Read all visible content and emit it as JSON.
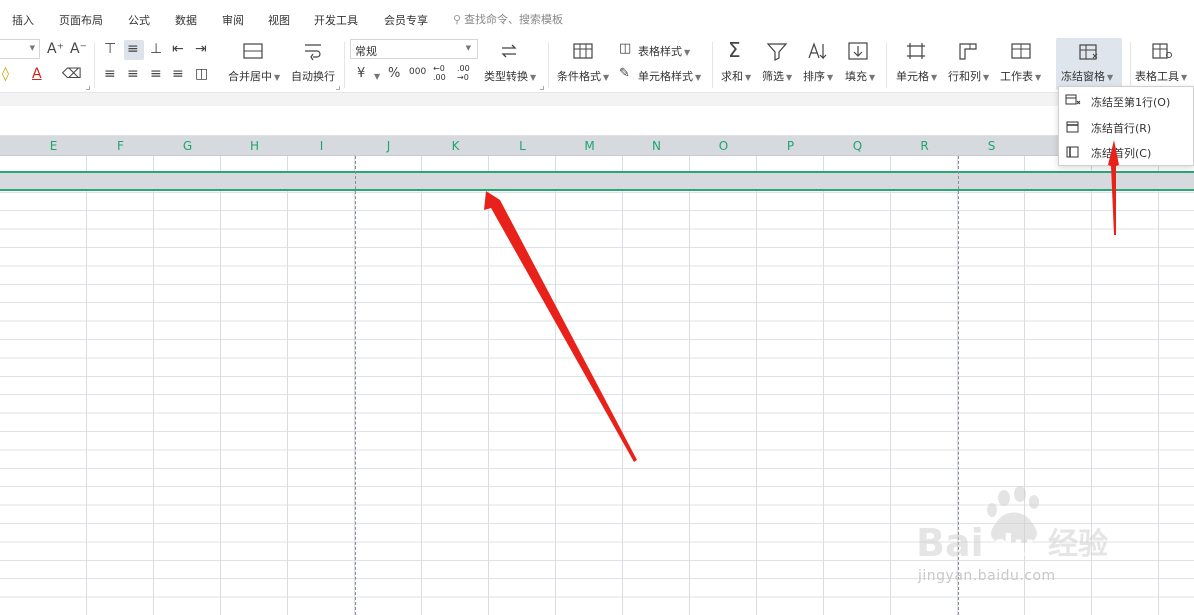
{
  "menu": {
    "items": [
      "插入",
      "页面布局",
      "公式",
      "数据",
      "审阅",
      "视图",
      "开发工具",
      "会员专享"
    ],
    "search_placeholder": "查找命令、搜索模板",
    "search_icon": "search-icon"
  },
  "toolbar": {
    "font_increase": "A⁺",
    "font_decrease": "A⁻",
    "merge_center": "合并居中",
    "wrap_text": "自动换行",
    "number_format": "常规",
    "currency": "¥",
    "percent": "%",
    "thousands": "000",
    "dec_increase": "←0 .00",
    "dec_decrease": ".00 →0",
    "type_convert": "类型转换",
    "conditional_format": "条件格式",
    "table_style": "表格样式",
    "cell_style": "单元格样式",
    "sum": "求和",
    "filter": "筛选",
    "sort": "排序",
    "fill": "填充",
    "cell": "单元格",
    "row_col": "行和列",
    "worksheet": "工作表",
    "freeze_panes": "冻结窗格",
    "table_tools": "表格工具"
  },
  "columns": [
    "E",
    "F",
    "G",
    "H",
    "I",
    "J",
    "K",
    "L",
    "M",
    "N",
    "O",
    "P",
    "Q",
    "R",
    "S"
  ],
  "freeze_menu": {
    "items": [
      {
        "label": "冻结至第1行(O)",
        "icon": "freeze-row-icon"
      },
      {
        "label": "冻结首行(R)",
        "icon": "freeze-first-row-icon"
      },
      {
        "label": "冻结首列(C)",
        "icon": "freeze-first-column-icon"
      }
    ]
  },
  "watermark": {
    "logo": "Baidu经验",
    "url": "jingyan.baidu.com"
  },
  "colors": {
    "accent_green": "#28a874",
    "header_gray": "#d6d9de",
    "arrow_red": "#e8221b"
  }
}
